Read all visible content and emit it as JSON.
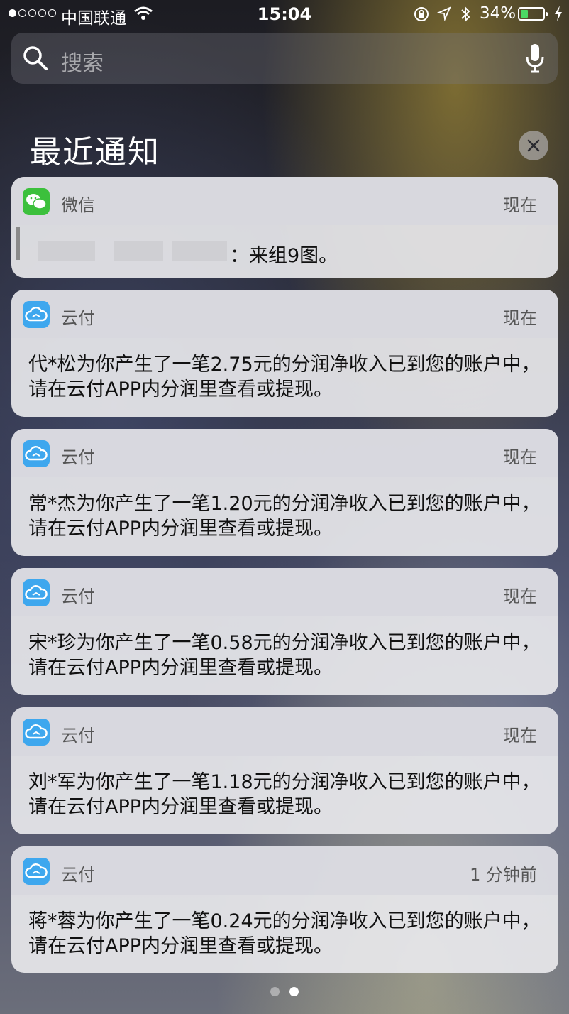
{
  "status_bar": {
    "carrier": "中国联通",
    "time": "15:04",
    "battery_percent": "34%",
    "battery_level": 0.34,
    "signal_bars": 1
  },
  "search": {
    "placeholder": "搜索"
  },
  "section": {
    "title": "最近通知"
  },
  "notifications": [
    {
      "app": "微信",
      "time": "现在",
      "body": "：来组9图。",
      "icon": "wechat-icon"
    },
    {
      "app": "云付",
      "time": "现在",
      "body": "代*松为你产生了一笔2.75元的分润净收入已到您的账户中，请在云付APP内分润里查看或提现。",
      "icon": "yunfu-cloud-icon"
    },
    {
      "app": "云付",
      "time": "现在",
      "body": "常*杰为你产生了一笔1.20元的分润净收入已到您的账户中，请在云付APP内分润里查看或提现。",
      "icon": "yunfu-cloud-icon"
    },
    {
      "app": "云付",
      "time": "现在",
      "body": "宋*珍为你产生了一笔0.58元的分润净收入已到您的账户中，请在云付APP内分润里查看或提现。",
      "icon": "yunfu-cloud-icon"
    },
    {
      "app": "云付",
      "time": "现在",
      "body": "刘*军为你产生了一笔1.18元的分润净收入已到您的账户中，请在云付APP内分润里查看或提现。",
      "icon": "yunfu-cloud-icon"
    },
    {
      "app": "云付",
      "time": "1 分钟前",
      "body": "蒋*蓉为你产生了一笔0.24元的分润净收入已到您的账户中，请在云付APP内分润里查看或提现。",
      "icon": "yunfu-cloud-icon"
    }
  ],
  "page_indicator": {
    "count": 2,
    "active": 2
  },
  "colors": {
    "wechat": "#3cc03c",
    "yunfu": "#3ea7ee",
    "battery": "#4cd964"
  }
}
